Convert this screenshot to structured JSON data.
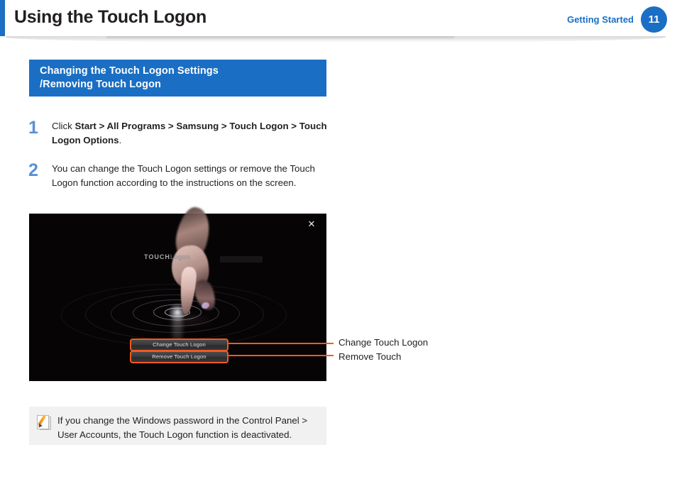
{
  "header": {
    "title": "Using the Touch Logon",
    "breadcrumb": "Getting Started",
    "page_number": "11",
    "accent_color": "#1a6fc4"
  },
  "section": {
    "heading_line_1": "Changing the Touch Logon Settings",
    "heading_line_2": "/Removing Touch Logon",
    "background_color": "#1a6fc4"
  },
  "steps": [
    {
      "number": "1",
      "text_prefix": "Click ",
      "bold_1": "Start > All Programs > Samsung > Touch Logon > Touch Logon Options",
      "text_suffix": "."
    },
    {
      "number": "2",
      "text": "You can change the Touch Logon settings or remove the Touch Logon function according to the instructions on the screen."
    }
  ],
  "screenshot": {
    "close_icon": "close-icon",
    "brand_bold": "TOUCH",
    "brand_light": "Logon",
    "buttons": [
      {
        "label": "Change Touch Logon"
      },
      {
        "label": "Remove Touch Logon"
      }
    ],
    "highlight_color": "#f05a1e",
    "background_color": "#060405"
  },
  "callouts": [
    {
      "label": "Change Touch Logon"
    },
    {
      "label": "Remove Touch"
    }
  ],
  "note": {
    "icon": "note-pencil-icon",
    "text": "If you change the Windows password in the Control Panel > User Accounts, the Touch Logon function is deactivated.",
    "background_color": "#f1f1f1"
  }
}
